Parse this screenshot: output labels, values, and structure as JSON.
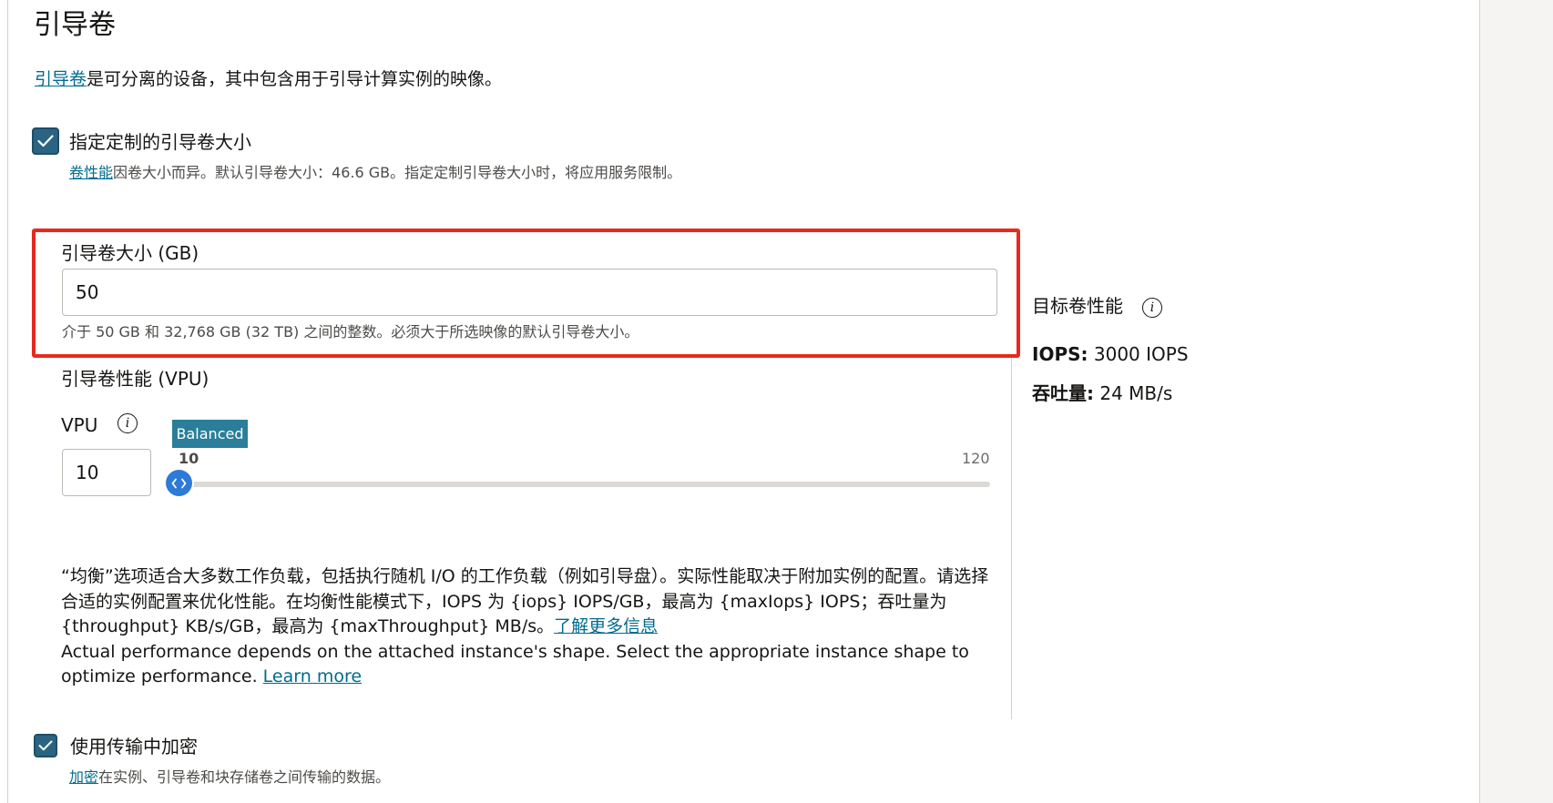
{
  "section": {
    "title": "引导卷",
    "intro_link": "引导卷",
    "intro_text": "是可分离的设备，其中包含用于引导计算实例的映像。"
  },
  "custom_size": {
    "checked": true,
    "label": "指定定制的引导卷大小",
    "help_link": "卷性能",
    "help_text": "因卷大小而异。默认引导卷大小：46.6 GB。指定定制引导卷大小时，将应用服务限制。"
  },
  "boot_volume_size": {
    "label": "引导卷大小 (GB)",
    "value": "50",
    "help": "介于 50 GB 和 32,768 GB (32 TB) 之间的整数。必须大于所选映像的默认引导卷大小。"
  },
  "vpu": {
    "section_label": "引导卷性能 (VPU)",
    "label": "VPU",
    "info_icon": "info-icon",
    "value": "10",
    "slider": {
      "badge": "Balanced",
      "min_label": "10",
      "max_label": "120",
      "min": 10,
      "max": 120,
      "value": 10
    },
    "desc_zh": "“均衡”选项适合大多数工作负载，包括执行随机 I/O 的工作负载（例如引导盘）。实际性能取决于附加实例的配置。请选择合适的实例配置来优化性能。在均衡性能模式下，IOPS 为 {iops} IOPS/GB，最高为 {maxIops} IOPS；吞吐量为 {throughput} KB/s/GB，最高为 {maxThroughput} MB/s。",
    "desc_zh_link": "了解更多信息",
    "desc_en": "Actual performance depends on the attached instance's shape. Select the appropriate instance shape to optimize performance. ",
    "desc_en_link": "Learn more"
  },
  "target_performance": {
    "title": "目标卷性能",
    "iops_key": "IOPS:",
    "iops_value": "3000 IOPS",
    "throughput_key": "吞吐量:",
    "throughput_value": "24 MB/s"
  },
  "encryption": {
    "checked": true,
    "label": "使用传输中加密",
    "help_link": "加密",
    "help_text": "在实例、引导卷和块存储卷之间传输的数据。"
  },
  "colors": {
    "accent": "#006b8f",
    "checkbox": "#2b6483",
    "highlight": "#e8291e",
    "badge": "#2a7e99",
    "slider_handle": "#2d7bd6"
  }
}
